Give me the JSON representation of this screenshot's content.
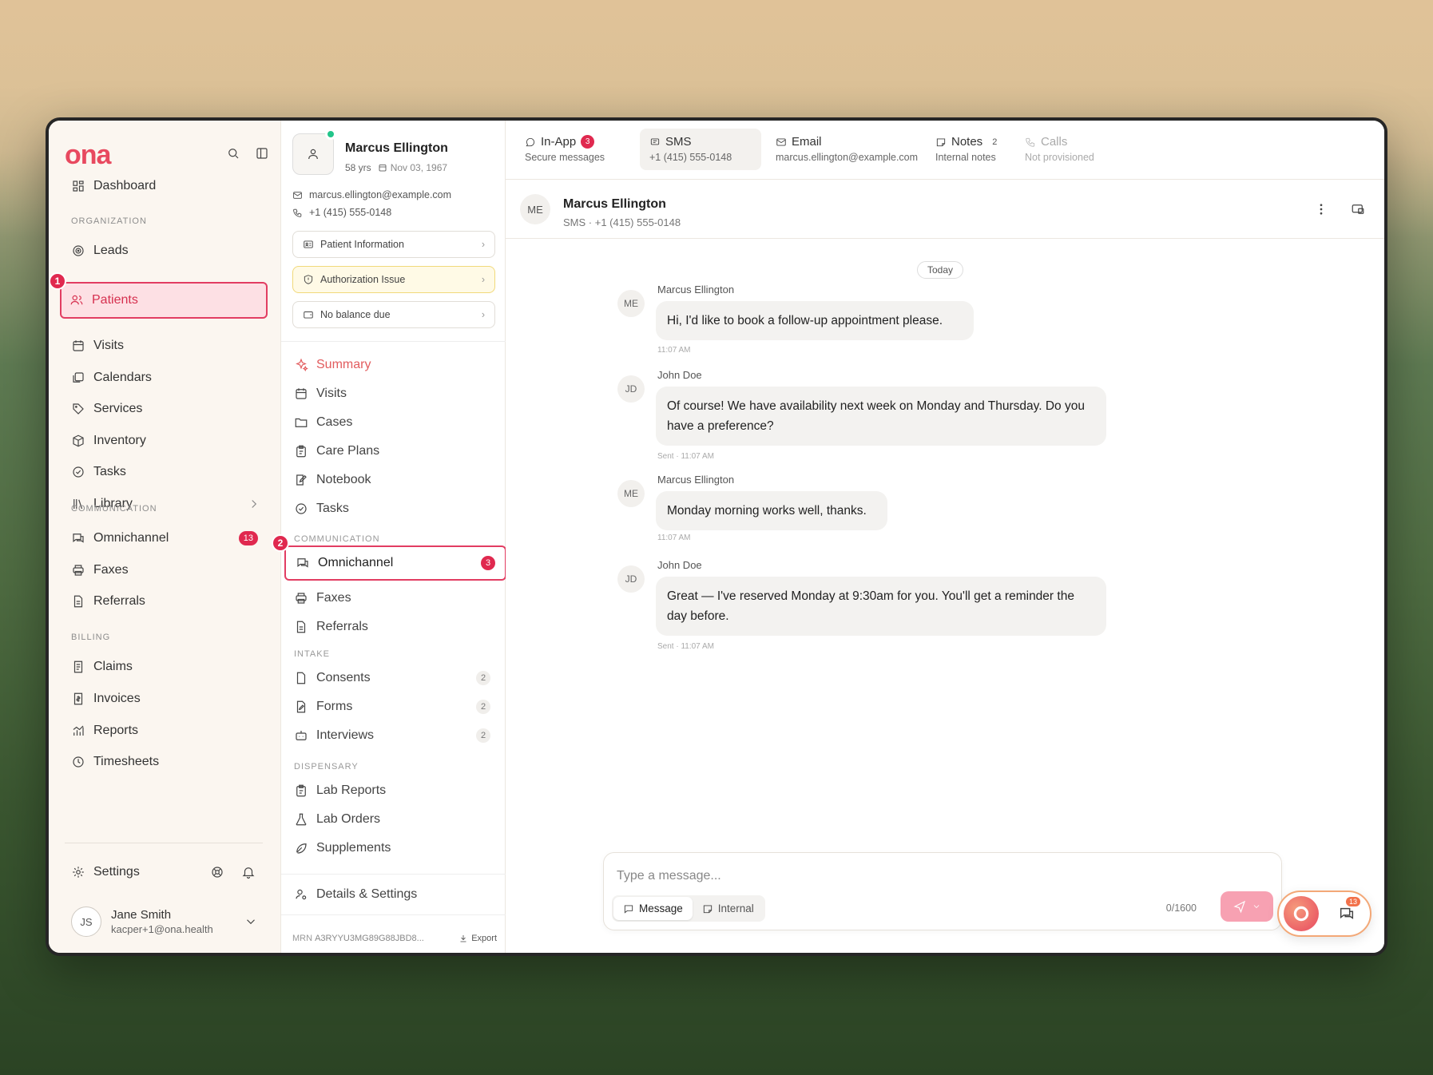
{
  "app": {
    "logo": "ona"
  },
  "sidebar": {
    "items": [
      {
        "label": "Dashboard"
      },
      {
        "label": "Leads"
      },
      {
        "label": "Patients"
      },
      {
        "label": "Visits"
      },
      {
        "label": "Calendars"
      },
      {
        "label": "Services"
      },
      {
        "label": "Inventory"
      },
      {
        "label": "Tasks"
      },
      {
        "label": "Library"
      },
      {
        "label": "Omnichannel",
        "badge": "13"
      },
      {
        "label": "Faxes"
      },
      {
        "label": "Referrals"
      },
      {
        "label": "Claims"
      },
      {
        "label": "Invoices"
      },
      {
        "label": "Reports"
      },
      {
        "label": "Timesheets"
      }
    ],
    "sections": {
      "organization": "ORGANIZATION",
      "communication": "COMMUNICATION",
      "billing": "BILLING"
    },
    "settings_label": "Settings",
    "user": {
      "initials": "JS",
      "name": "Jane Smith",
      "email": "kacper+1@ona.health"
    },
    "step_markers": [
      "1",
      "2"
    ]
  },
  "patient": {
    "name": "Marcus Ellington",
    "age": "58 yrs",
    "dob": "Nov 03, 1967",
    "email": "marcus.ellington@example.com",
    "phone": "+1 (415) 555-0148",
    "buttons": {
      "info": "Patient Information",
      "auth": "Authorization Issue",
      "balance": "No balance due"
    },
    "nav": {
      "summary": "Summary",
      "visits": "Visits",
      "cases": "Cases",
      "care_plans": "Care Plans",
      "notebook": "Notebook",
      "tasks": "Tasks",
      "communication_section": "COMMUNICATION",
      "omnichannel": "Omnichannel",
      "omnichannel_count": "3",
      "faxes": "Faxes",
      "referrals": "Referrals",
      "intake_section": "INTAKE",
      "consents": "Consents",
      "consents_count": "2",
      "forms": "Forms",
      "forms_count": "2",
      "interviews": "Interviews",
      "interviews_count": "2",
      "dispensary_section": "DISPENSARY",
      "lab_reports": "Lab Reports",
      "lab_orders": "Lab Orders",
      "supplements": "Supplements",
      "details": "Details & Settings"
    },
    "mrn_label": "MRN",
    "mrn": "A3RYYU3MG89G88JBD8...",
    "export": "Export"
  },
  "channels": [
    {
      "name": "In-App",
      "sub": "Secure messages",
      "badge": "3"
    },
    {
      "name": "SMS",
      "sub": "+1 (415) 555-0148"
    },
    {
      "name": "Email",
      "sub": "marcus.ellington@example.com"
    },
    {
      "name": "Notes",
      "sub": "Internal notes",
      "count": "2"
    },
    {
      "name": "Calls",
      "sub": "Not provisioned"
    }
  ],
  "conversation": {
    "initials": "ME",
    "name": "Marcus Ellington",
    "sub": "SMS · +1 (415) 555-0148",
    "day_label": "Today",
    "messages": [
      {
        "initials": "ME",
        "sender": "Marcus Ellington",
        "text": "Hi, I'd like to book a follow-up appointment please.",
        "time": "11:07 AM"
      },
      {
        "initials": "JD",
        "sender": "John Doe",
        "text": "Of course! We have availability next week on Monday and Thursday. Do you have a preference?",
        "time": "Sent · 11:07 AM"
      },
      {
        "initials": "ME",
        "sender": "Marcus Ellington",
        "text": "Monday morning works well, thanks.",
        "time": "11:07 AM"
      },
      {
        "initials": "JD",
        "sender": "John Doe",
        "text": "Great — I've reserved Monday at 9:30am for you. You'll get a reminder the day before.",
        "time": "Sent · 11:07 AM"
      }
    ]
  },
  "composer": {
    "placeholder": "Type a message...",
    "mode_message": "Message",
    "mode_internal": "Internal",
    "char_count": "0/1600"
  },
  "fab": {
    "badge": "13"
  },
  "colors": {
    "accent": "#e0294f",
    "brand": "#e8495f",
    "brand_alt": "#f2714a"
  }
}
